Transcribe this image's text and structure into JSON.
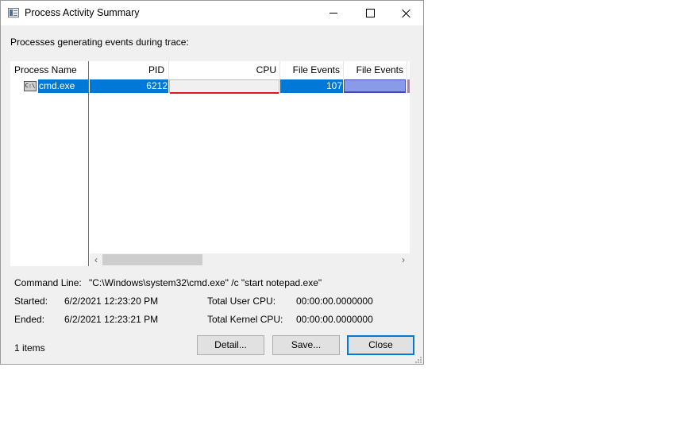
{
  "window": {
    "title": "Process Activity Summary",
    "prompt": "Processes generating events during trace:"
  },
  "table": {
    "columns": [
      "Process Name",
      "PID",
      "CPU",
      "File Events",
      "File Events"
    ],
    "rows": [
      {
        "process_name": "cmd.exe",
        "pid": "6212",
        "cpu": "",
        "file_events": "107",
        "file_events_bar": ""
      }
    ]
  },
  "details": {
    "command_line_label": "Command Line:",
    "command_line_value": "\"C:\\Windows\\system32\\cmd.exe\" /c \"start notepad.exe\"",
    "started_label": "Started:",
    "started_value": "6/2/2021 12:23:20 PM",
    "ended_label": "Ended:",
    "ended_value": "6/2/2021 12:23:21 PM",
    "user_cpu_label": "Total User CPU:",
    "user_cpu_value": "00:00:00.0000000",
    "kernel_cpu_label": "Total Kernel CPU:",
    "kernel_cpu_value": "00:00:00.0000000"
  },
  "footer": {
    "item_count": "1 items",
    "detail_label": "Detail...",
    "save_label": "Save...",
    "close_label": "Close"
  },
  "colors": {
    "selection": "#0078d7",
    "cpu_line": "#e81123",
    "file_events_bar": "#8a9ae8"
  },
  "icons": {
    "app": "window-list-icon",
    "process": "console-icon"
  }
}
